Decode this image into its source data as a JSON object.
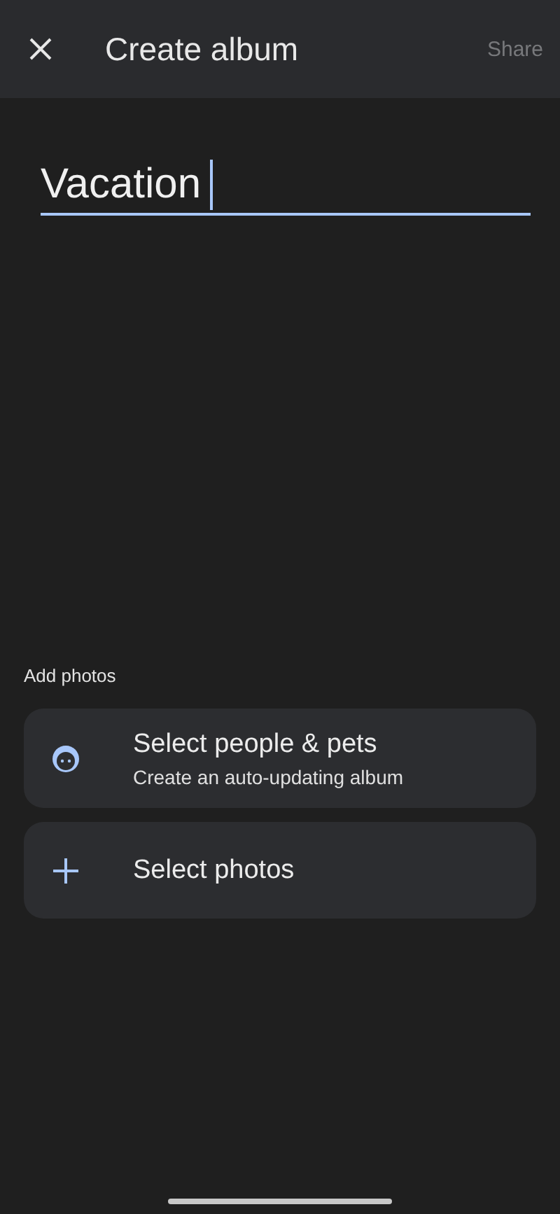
{
  "top_bar": {
    "title": "Create album",
    "share": {
      "label": "Share",
      "disabled": true
    }
  },
  "album_title": {
    "value": "Vacation",
    "focused": true
  },
  "add_photos": {
    "heading": "Add photos",
    "options": [
      {
        "kind": "people",
        "label": "Select people & pets",
        "sublabel": "Create an auto-updating album"
      },
      {
        "kind": "photos",
        "label": "Select photos"
      }
    ]
  }
}
